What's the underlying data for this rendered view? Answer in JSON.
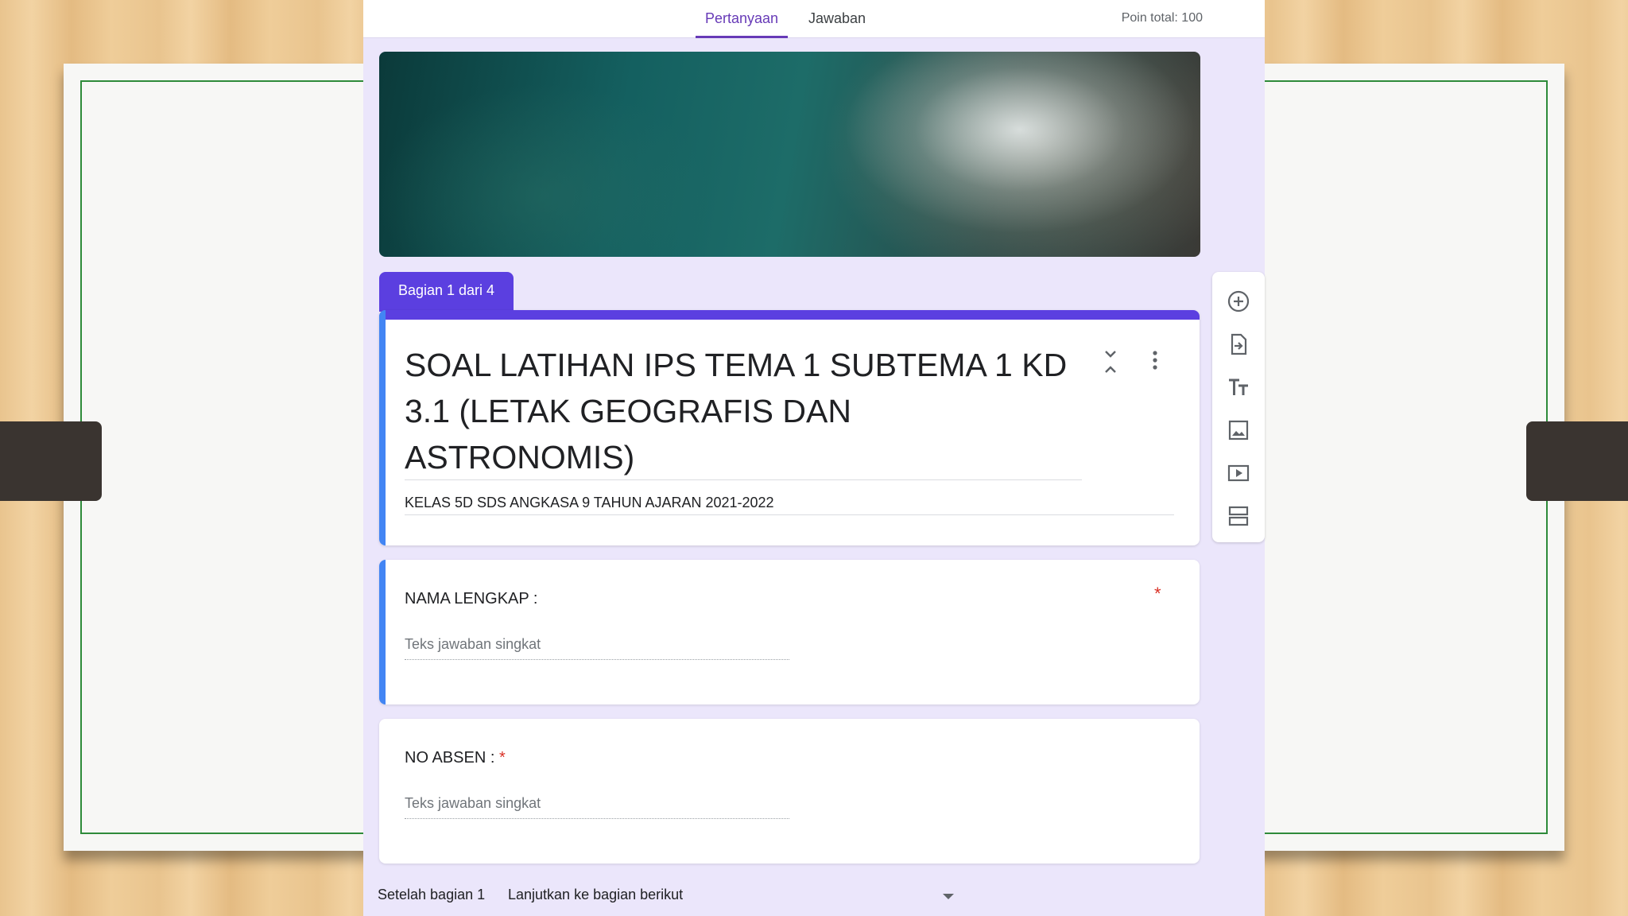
{
  "tabs": [
    {
      "label": "Pertanyaan",
      "active": true
    },
    {
      "label": "Jawaban",
      "active": false
    }
  ],
  "points_total": "Poin total: 100",
  "section": {
    "label": "Bagian 1 dari 4",
    "title": "SOAL LATIHAN IPS TEMA 1 SUBTEMA 1 KD 3.1 (LETAK GEOGRAFIS DAN ASTRONOMIS)",
    "description": "KELAS 5D SDS ANGKASA 9 TAHUN AJARAN 2021-2022"
  },
  "questions": [
    {
      "label": "NAMA LENGKAP :",
      "required_mark": "*",
      "answer_placeholder": "Teks jawaban singkat"
    },
    {
      "label": "NO ABSEN :",
      "required_mark": "*",
      "answer_placeholder": "Teks jawaban singkat"
    }
  ],
  "after_section": {
    "label": "Setelah bagian 1",
    "value": "Lanjutkan ke bagian berikut"
  },
  "toolbar_icons": [
    "add-question-icon",
    "import-questions-icon",
    "add-title-icon",
    "add-image-icon",
    "add-video-icon",
    "add-section-icon"
  ],
  "colors": {
    "accent": "#673ab7",
    "section_purple": "#5b3fe0",
    "focus_blue": "#4285f4",
    "required_red": "#d93025",
    "background_lavender": "#ebe6fb",
    "slide_border_green": "#2e8b3a"
  }
}
